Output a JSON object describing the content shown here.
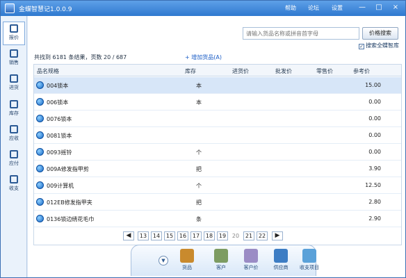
{
  "app": {
    "title": "金蝶智慧记1.0.0.9"
  },
  "top_links": [
    "帮助",
    "论坛",
    "设置"
  ],
  "window_controls": {
    "minimize": "—",
    "maximize": "□",
    "close": "×"
  },
  "sidebar": {
    "items": [
      {
        "label": "报价",
        "icon": "quote-icon",
        "active": true
      },
      {
        "label": "销售",
        "icon": "sales-cart-icon",
        "active": false
      },
      {
        "label": "进货",
        "icon": "purchase-cart-icon",
        "active": false
      },
      {
        "label": "库存",
        "icon": "inventory-icon",
        "active": false
      },
      {
        "label": "应收",
        "icon": "receivable-icon",
        "active": false
      },
      {
        "label": "应付",
        "icon": "payable-icon",
        "active": false
      },
      {
        "label": "收支",
        "icon": "chart-icon",
        "active": false
      }
    ]
  },
  "search": {
    "placeholder": "请输入货品名称或拼音首字母",
    "button": "价格搜索",
    "checkbox_label": "搜索全蝶智库",
    "checked": true
  },
  "summary": "共找到 6181 条结果，页数 20 / 687",
  "add_item": "+ 增加货品(A)",
  "table": {
    "headers": [
      "品名规格",
      "库存",
      "进货价",
      "批发价",
      "零售价",
      "参考价"
    ],
    "rows": [
      {
        "name": "004锁本",
        "unit": "本",
        "price": "15.00",
        "selected": true
      },
      {
        "name": "006锁本",
        "unit": "本",
        "price": "0.00",
        "selected": false
      },
      {
        "name": "0076锁本",
        "unit": "",
        "price": "0.00",
        "selected": false
      },
      {
        "name": "0081锁本",
        "unit": "",
        "price": "0.00",
        "selected": false
      },
      {
        "name": "0093摇铃",
        "unit": "个",
        "price": "0.00",
        "selected": false
      },
      {
        "name": "009A修发指甲剪",
        "unit": "把",
        "price": "3.90",
        "selected": false
      },
      {
        "name": "009计算机",
        "unit": "个",
        "price": "12.50",
        "selected": false
      },
      {
        "name": "012EB修发指甲夹",
        "unit": "把",
        "price": "2.80",
        "selected": false
      },
      {
        "name": "0136锁边绣花毛巾",
        "unit": "条",
        "price": "2.90",
        "selected": false
      }
    ]
  },
  "pagination": [
    "◀",
    "13",
    "14",
    "15",
    "16",
    "17",
    "18",
    "19",
    "20",
    "21",
    "22",
    "▶"
  ],
  "dock": {
    "collapse": "▼",
    "items": [
      {
        "label": "货品",
        "icon": "goods-icon",
        "color": "#c98a2d"
      },
      {
        "label": "客户",
        "icon": "customer-icon",
        "color": "#7d9c62"
      },
      {
        "label": "客户价",
        "icon": "customer-price-icon",
        "color": "#9b8cc5"
      },
      {
        "label": "供应商",
        "icon": "supplier-icon",
        "color": "#3d7dc4"
      },
      {
        "label": "收支项目",
        "icon": "income-expense-icon",
        "color": "#5aa1d9"
      }
    ]
  }
}
